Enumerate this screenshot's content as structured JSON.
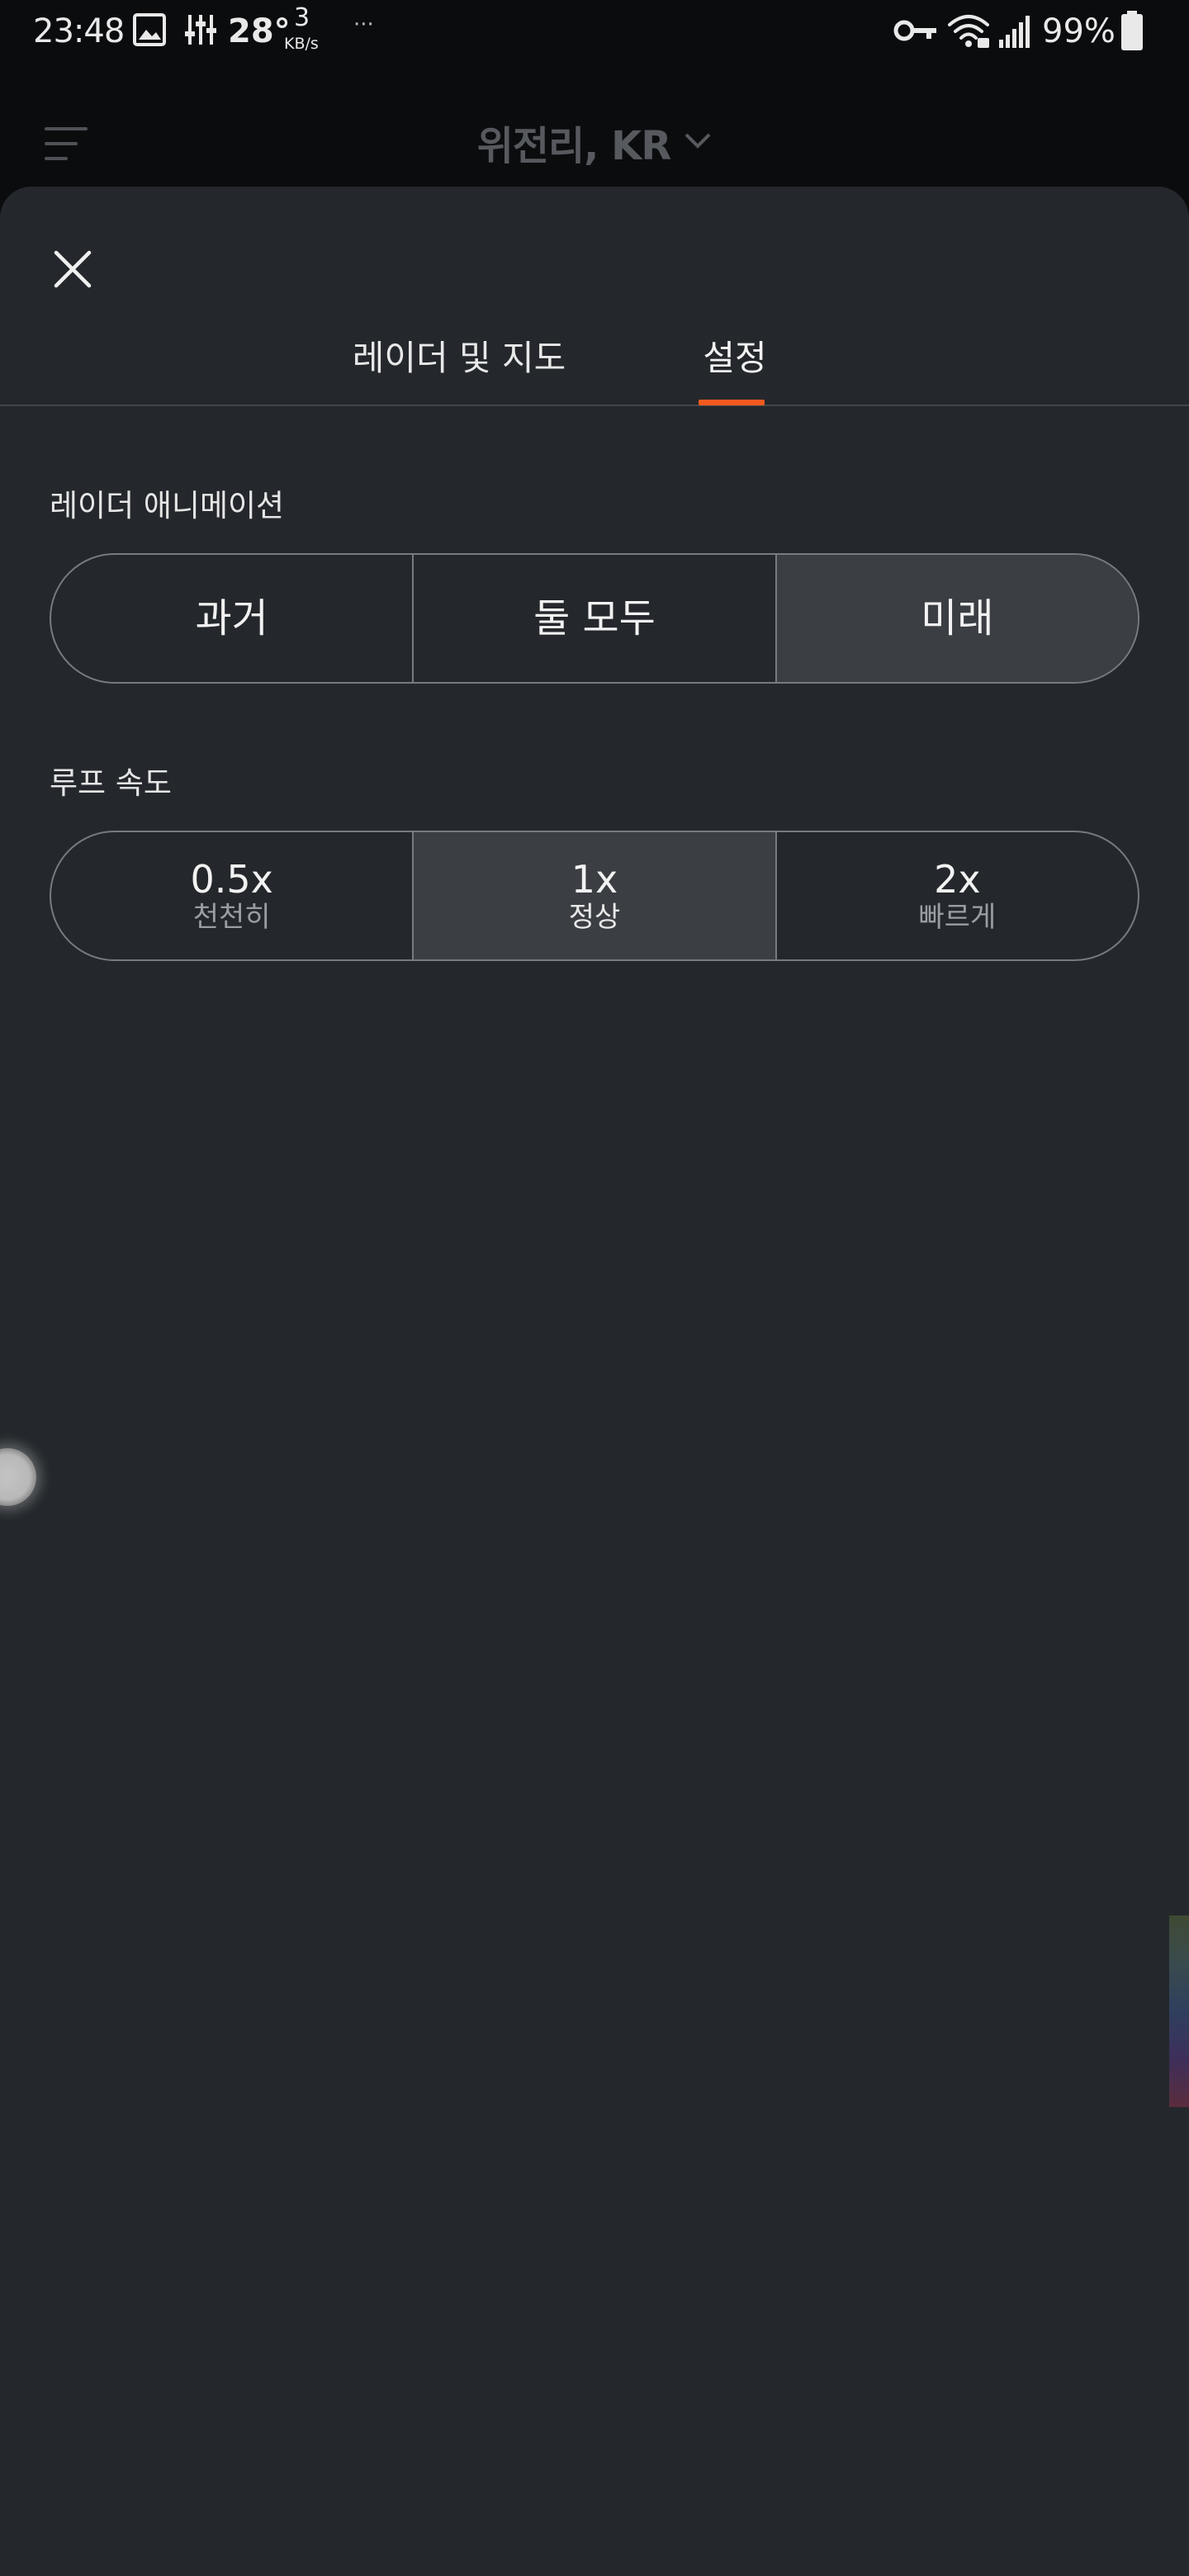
{
  "status_bar": {
    "time": "23:48",
    "temperature": "28°",
    "net_speed_value": "3",
    "net_speed_unit": "KB/s",
    "more": "···",
    "battery": "99%",
    "icons": [
      "image-icon",
      "equalizer-icon",
      "key-icon",
      "wifi-icon",
      "signal-icon",
      "battery-icon"
    ]
  },
  "header": {
    "location": "위전리, KR",
    "menu_icon": "hamburger-menu-icon",
    "dropdown_icon": "chevron-down-icon"
  },
  "sheet": {
    "close_icon": "close-icon",
    "tabs": [
      {
        "label": "레이더 및 지도",
        "active": false
      },
      {
        "label": "설정",
        "active": true
      }
    ],
    "accent_color": "#f25a1f",
    "radar_animation": {
      "label": "레이더 애니메이션",
      "options": [
        {
          "label": "과거",
          "selected": false
        },
        {
          "label": "둘 모두",
          "selected": false
        },
        {
          "label": "미래",
          "selected": true
        }
      ]
    },
    "loop_speed": {
      "label": "루프 속도",
      "options": [
        {
          "value": "0.5x",
          "caption": "천천히",
          "selected": false
        },
        {
          "value": "1x",
          "caption": "정상",
          "selected": true
        },
        {
          "value": "2x",
          "caption": "빠르게",
          "selected": false
        }
      ]
    }
  }
}
